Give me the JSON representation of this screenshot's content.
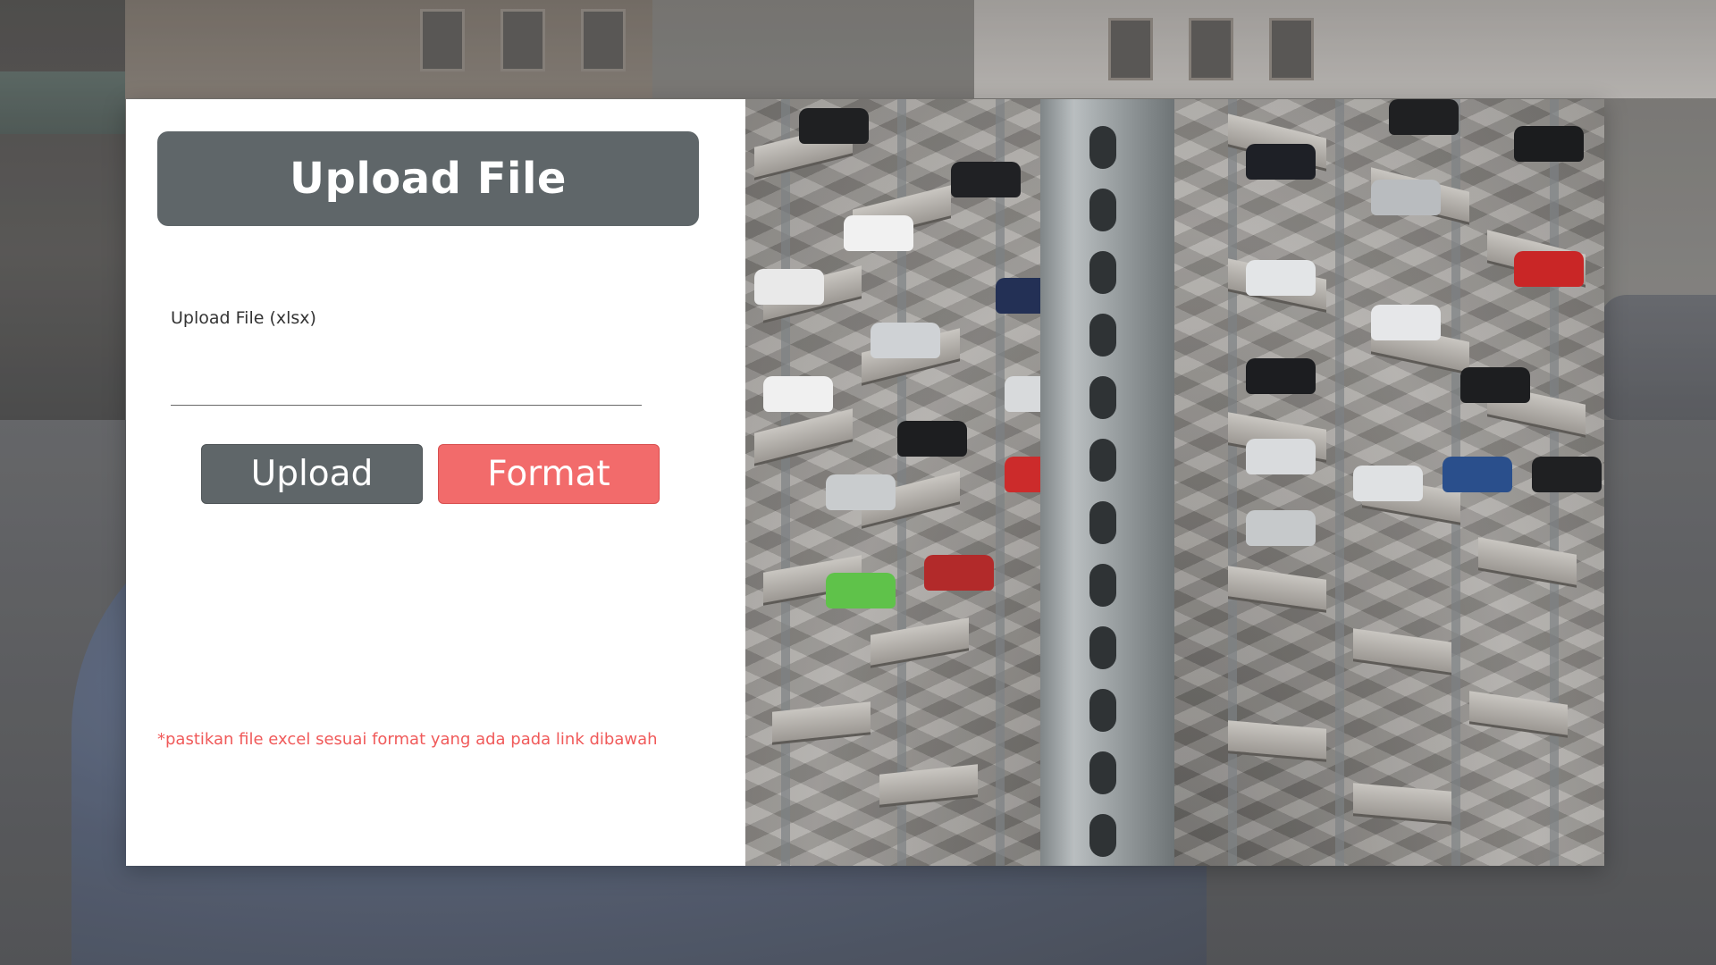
{
  "title": "Upload File",
  "form": {
    "field_label": "Upload File (xlsx)",
    "file_value": ""
  },
  "buttons": {
    "upload_label": "Upload",
    "format_label": "Format"
  },
  "note": "*pastikan file excel sesuai format yang ada pada link dibawah",
  "colors": {
    "title_bar": "#5f6669",
    "upload_button": "#5f6669",
    "format_button": "#f26b6b",
    "note_text": "#f05a5a"
  }
}
